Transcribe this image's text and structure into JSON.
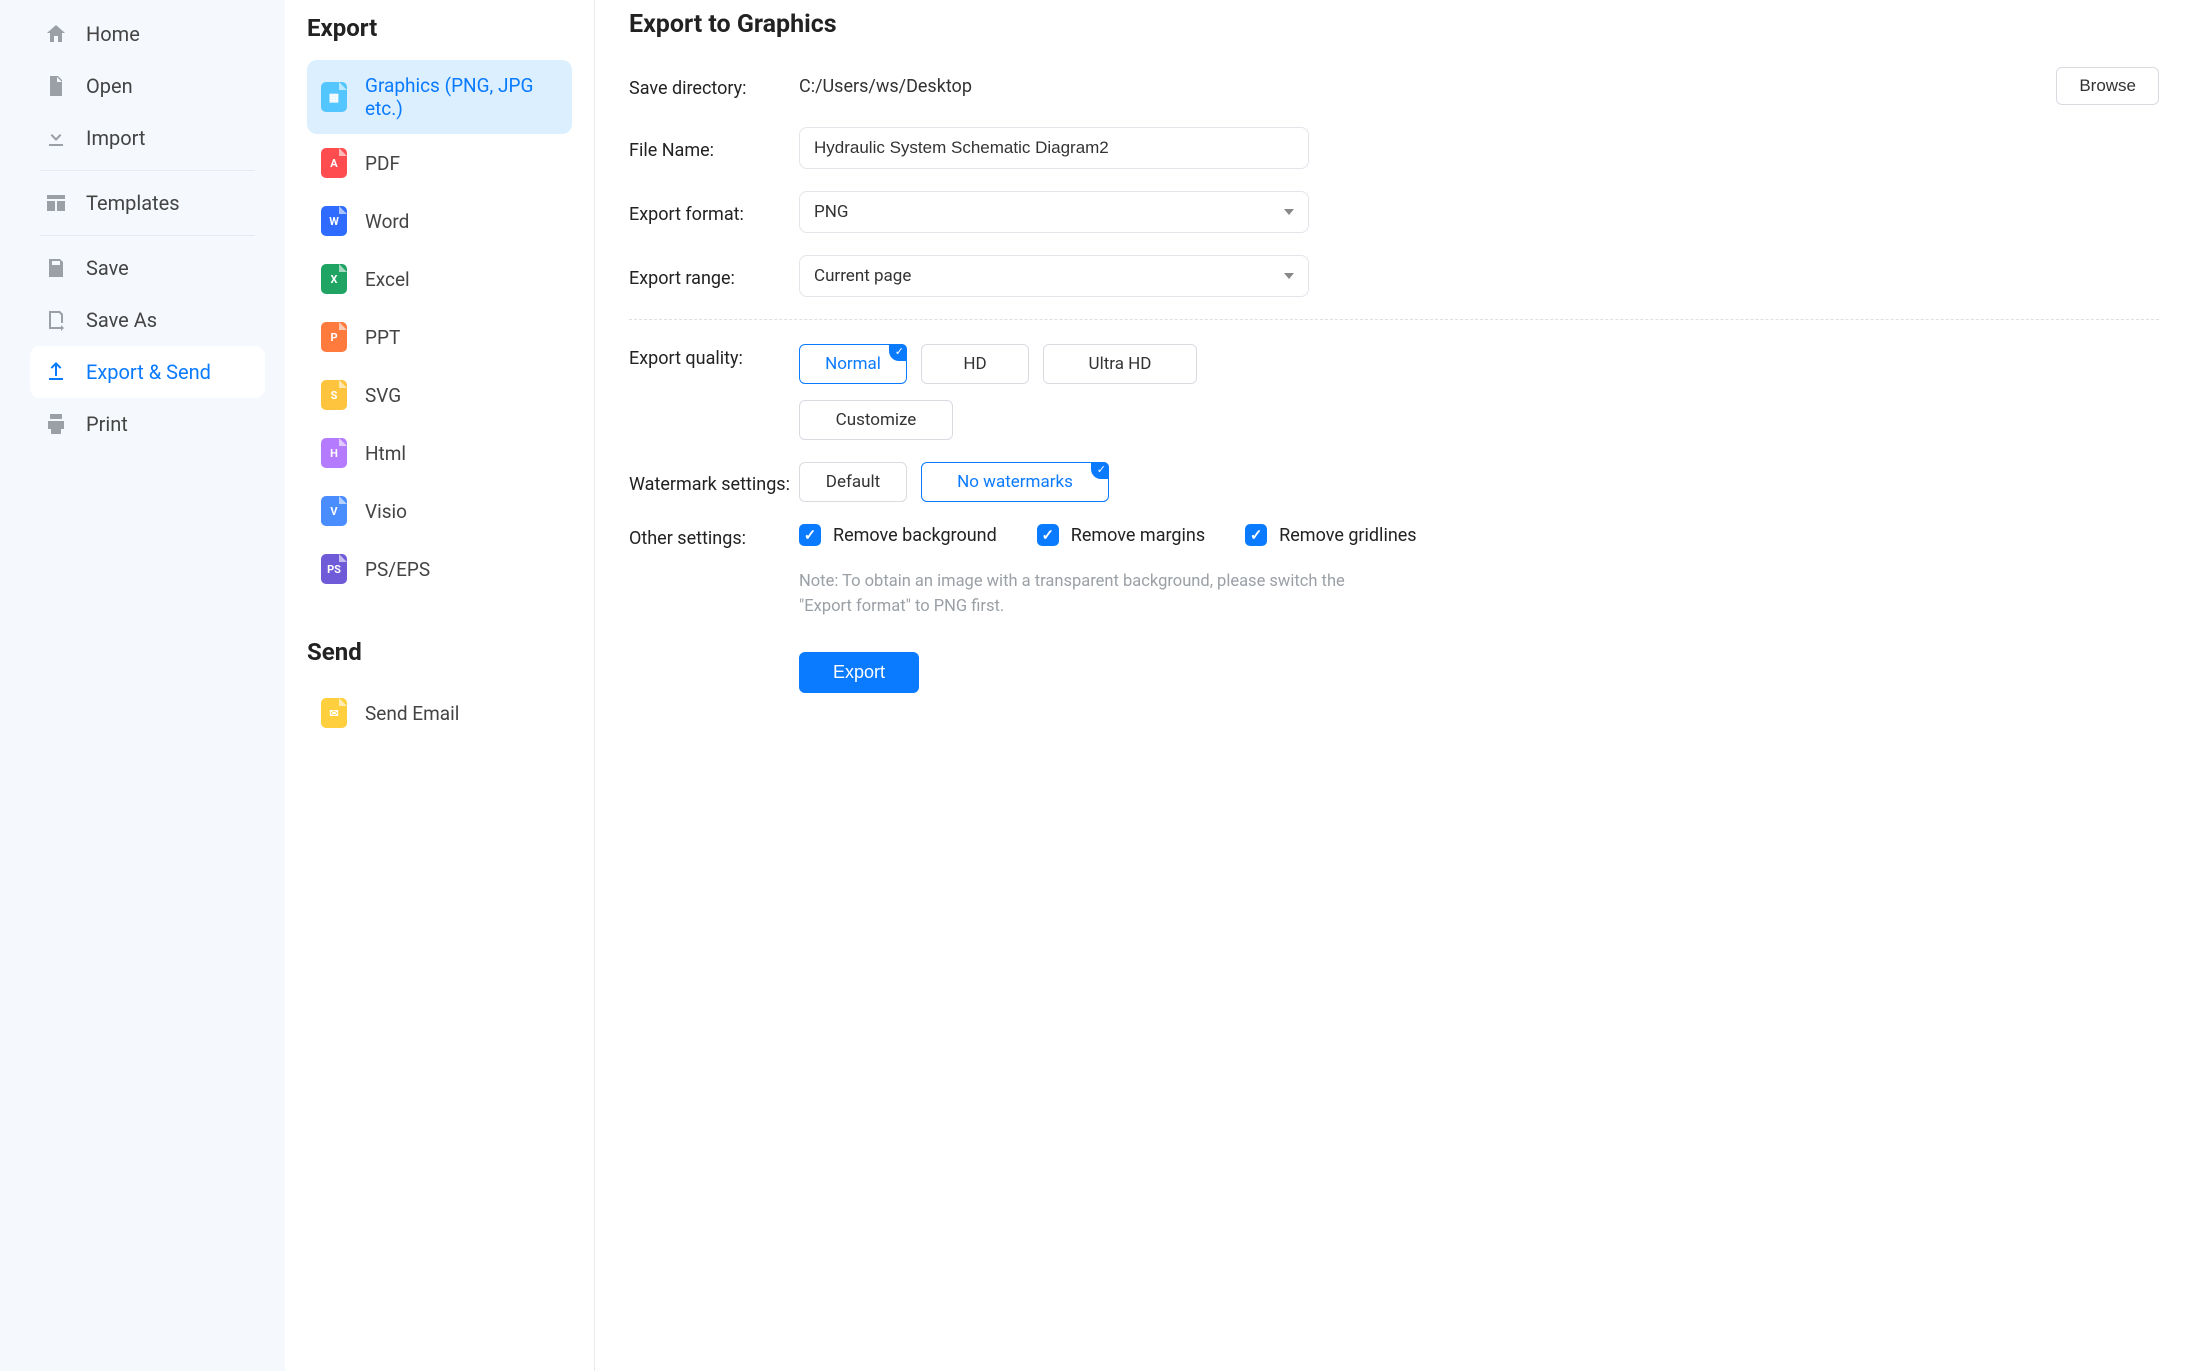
{
  "sidebar": {
    "items": [
      {
        "label": "Home"
      },
      {
        "label": "Open"
      },
      {
        "label": "Import"
      },
      {
        "label": "Templates"
      },
      {
        "label": "Save"
      },
      {
        "label": "Save As"
      },
      {
        "label": "Export & Send"
      },
      {
        "label": "Print"
      }
    ]
  },
  "midcol": {
    "export_heading": "Export",
    "send_heading": "Send",
    "items": [
      {
        "label": "Graphics (PNG, JPG etc.)"
      },
      {
        "label": "PDF"
      },
      {
        "label": "Word"
      },
      {
        "label": "Excel"
      },
      {
        "label": "PPT"
      },
      {
        "label": "SVG"
      },
      {
        "label": "Html"
      },
      {
        "label": "Visio"
      },
      {
        "label": "PS/EPS"
      }
    ],
    "send_items": [
      {
        "label": "Send Email"
      }
    ]
  },
  "main": {
    "title": "Export to Graphics",
    "labels": {
      "save_directory": "Save directory:",
      "file_name": "File Name:",
      "export_format": "Export format:",
      "export_range": "Export range:",
      "export_quality": "Export quality:",
      "watermark": "Watermark settings:",
      "other": "Other settings:"
    },
    "values": {
      "save_directory": "C:/Users/ws/Desktop",
      "file_name": "Hydraulic System Schematic Diagram2",
      "export_format": "PNG",
      "export_range": "Current page"
    },
    "browse_label": "Browse",
    "quality_options": {
      "normal": "Normal",
      "hd": "HD",
      "ultra": "Ultra HD",
      "customize": "Customize"
    },
    "watermark_options": {
      "default": "Default",
      "none": "No watermarks"
    },
    "other_options": {
      "remove_bg": "Remove background",
      "remove_margins": "Remove margins",
      "remove_gridlines": "Remove gridlines"
    },
    "note": "Note: To obtain an image with a transparent background, please switch the \"Export format\" to PNG first.",
    "export_button": "Export"
  }
}
